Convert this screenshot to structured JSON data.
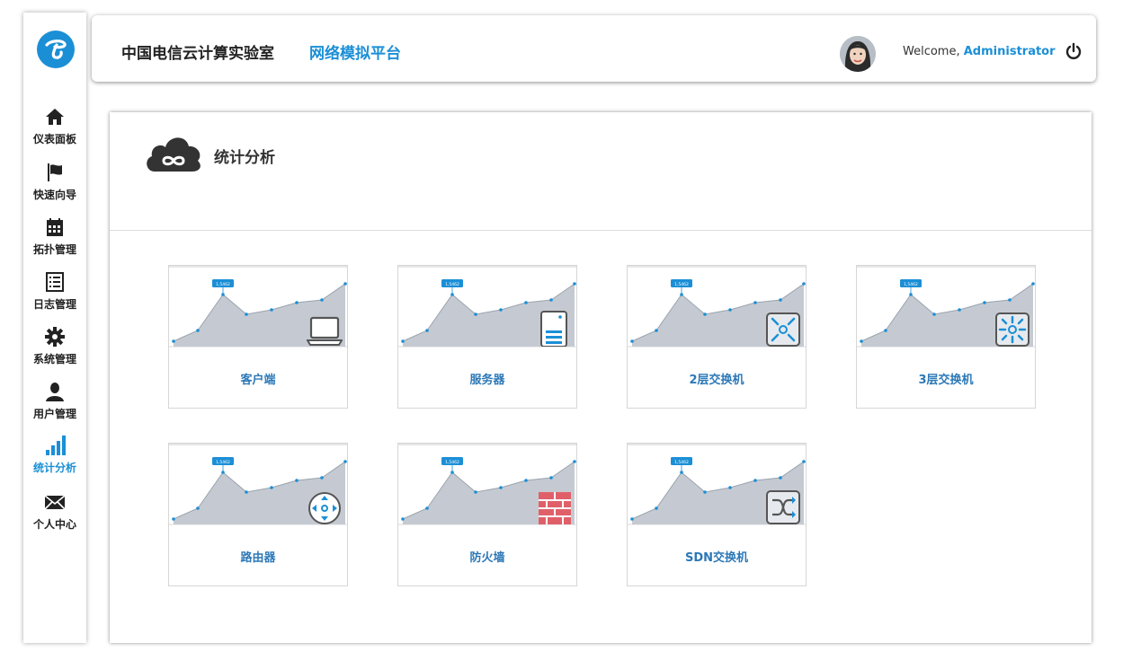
{
  "header": {
    "org_title": "中国电信云计算实验室",
    "platform_title": "网络模拟平台",
    "welcome_text": "Welcome,",
    "username": "Administrator"
  },
  "sidebar": {
    "items": [
      {
        "label": "仪表面板",
        "icon": "home-icon"
      },
      {
        "label": "快速向导",
        "icon": "flag-icon"
      },
      {
        "label": "拓扑管理",
        "icon": "calendar-icon"
      },
      {
        "label": "日志管理",
        "icon": "list-icon"
      },
      {
        "label": "系统管理",
        "icon": "gear-icon"
      },
      {
        "label": "用户管理",
        "icon": "user-icon"
      },
      {
        "label": "统计分析",
        "icon": "signal-bars-icon",
        "active": true
      },
      {
        "label": "个人中心",
        "icon": "envelope-icon"
      }
    ]
  },
  "main": {
    "title": "统计分析",
    "cards": [
      {
        "label": "客户端",
        "icon": "laptop-icon"
      },
      {
        "label": "服务器",
        "icon": "server-icon"
      },
      {
        "label": "2层交换机",
        "icon": "l2-switch-icon"
      },
      {
        "label": "3层交换机",
        "icon": "l3-switch-icon"
      },
      {
        "label": "路由器",
        "icon": "router-icon"
      },
      {
        "label": "防火墙",
        "icon": "firewall-icon"
      },
      {
        "label": "SDN交换机",
        "icon": "sdn-switch-icon"
      }
    ],
    "thumbnail_badge": "1,5462"
  },
  "colors": {
    "accent": "#1b8fd6",
    "caption": "#2c78b7",
    "firewall": "#e0606a"
  }
}
